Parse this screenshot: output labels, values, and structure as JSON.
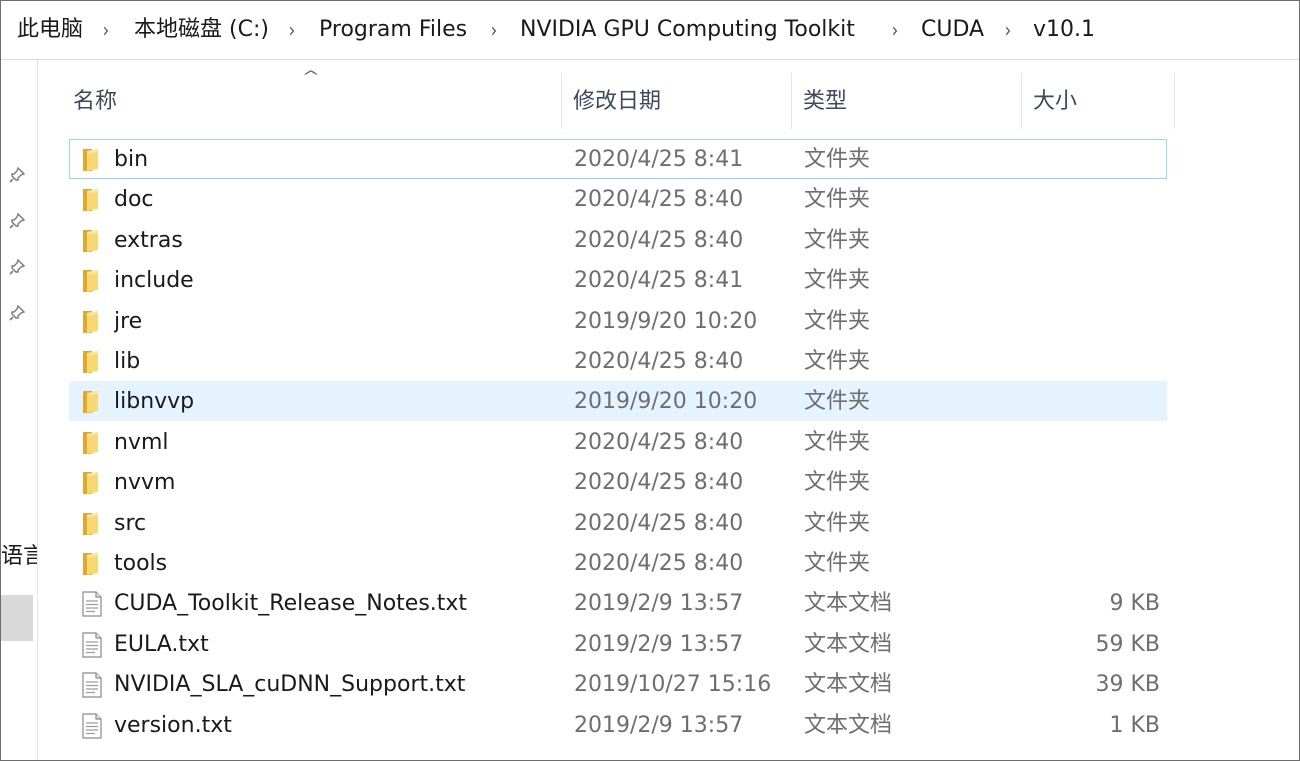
{
  "breadcrumb": {
    "items": [
      {
        "label": "此电脑"
      },
      {
        "label": "本地磁盘 (C:)"
      },
      {
        "label": "Program Files"
      },
      {
        "label": "NVIDIA GPU Computing Toolkit"
      },
      {
        "label": "CUDA"
      },
      {
        "label": "v10.1"
      }
    ],
    "separator": "›"
  },
  "nav": {
    "pin_icon": "pin-icon",
    "partial_label": "语言"
  },
  "columns": {
    "name": "名称",
    "date": "修改日期",
    "type": "类型",
    "size": "大小",
    "sort_indicator": "^"
  },
  "files": [
    {
      "name": "bin",
      "date": "2020/4/25 8:41",
      "type": "文件夹",
      "size": "",
      "icon": "folder-icon",
      "state": "focused"
    },
    {
      "name": "doc",
      "date": "2020/4/25 8:40",
      "type": "文件夹",
      "size": "",
      "icon": "folder-icon",
      "state": ""
    },
    {
      "name": "extras",
      "date": "2020/4/25 8:40",
      "type": "文件夹",
      "size": "",
      "icon": "folder-icon",
      "state": ""
    },
    {
      "name": "include",
      "date": "2020/4/25 8:41",
      "type": "文件夹",
      "size": "",
      "icon": "folder-icon",
      "state": ""
    },
    {
      "name": "jre",
      "date": "2019/9/20 10:20",
      "type": "文件夹",
      "size": "",
      "icon": "folder-icon",
      "state": ""
    },
    {
      "name": "lib",
      "date": "2020/4/25 8:40",
      "type": "文件夹",
      "size": "",
      "icon": "folder-icon",
      "state": ""
    },
    {
      "name": "libnvvp",
      "date": "2019/9/20 10:20",
      "type": "文件夹",
      "size": "",
      "icon": "folder-icon",
      "state": "hover"
    },
    {
      "name": "nvml",
      "date": "2020/4/25 8:40",
      "type": "文件夹",
      "size": "",
      "icon": "folder-icon",
      "state": ""
    },
    {
      "name": "nvvm",
      "date": "2020/4/25 8:40",
      "type": "文件夹",
      "size": "",
      "icon": "folder-icon",
      "state": ""
    },
    {
      "name": "src",
      "date": "2020/4/25 8:40",
      "type": "文件夹",
      "size": "",
      "icon": "folder-icon",
      "state": ""
    },
    {
      "name": "tools",
      "date": "2020/4/25 8:40",
      "type": "文件夹",
      "size": "",
      "icon": "folder-icon",
      "state": ""
    },
    {
      "name": "CUDA_Toolkit_Release_Notes.txt",
      "date": "2019/2/9 13:57",
      "type": "文本文档",
      "size": "9 KB",
      "icon": "text-file-icon",
      "state": ""
    },
    {
      "name": "EULA.txt",
      "date": "2019/2/9 13:57",
      "type": "文本文档",
      "size": "59 KB",
      "icon": "text-file-icon",
      "state": ""
    },
    {
      "name": "NVIDIA_SLA_cuDNN_Support.txt",
      "date": "2019/10/27 15:16",
      "type": "文本文档",
      "size": "39 KB",
      "icon": "text-file-icon",
      "state": ""
    },
    {
      "name": "version.txt",
      "date": "2019/2/9 13:57",
      "type": "文本文档",
      "size": "1 KB",
      "icon": "text-file-icon",
      "state": ""
    }
  ],
  "colors": {
    "hover_row": "#e5f3ff",
    "focus_border": "#99d1ff",
    "folder_yellow": "#f8d775",
    "folder_dark": "#e0a92e",
    "header_text": "#3d4a5c",
    "secondary_text": "#6e6e6e"
  }
}
